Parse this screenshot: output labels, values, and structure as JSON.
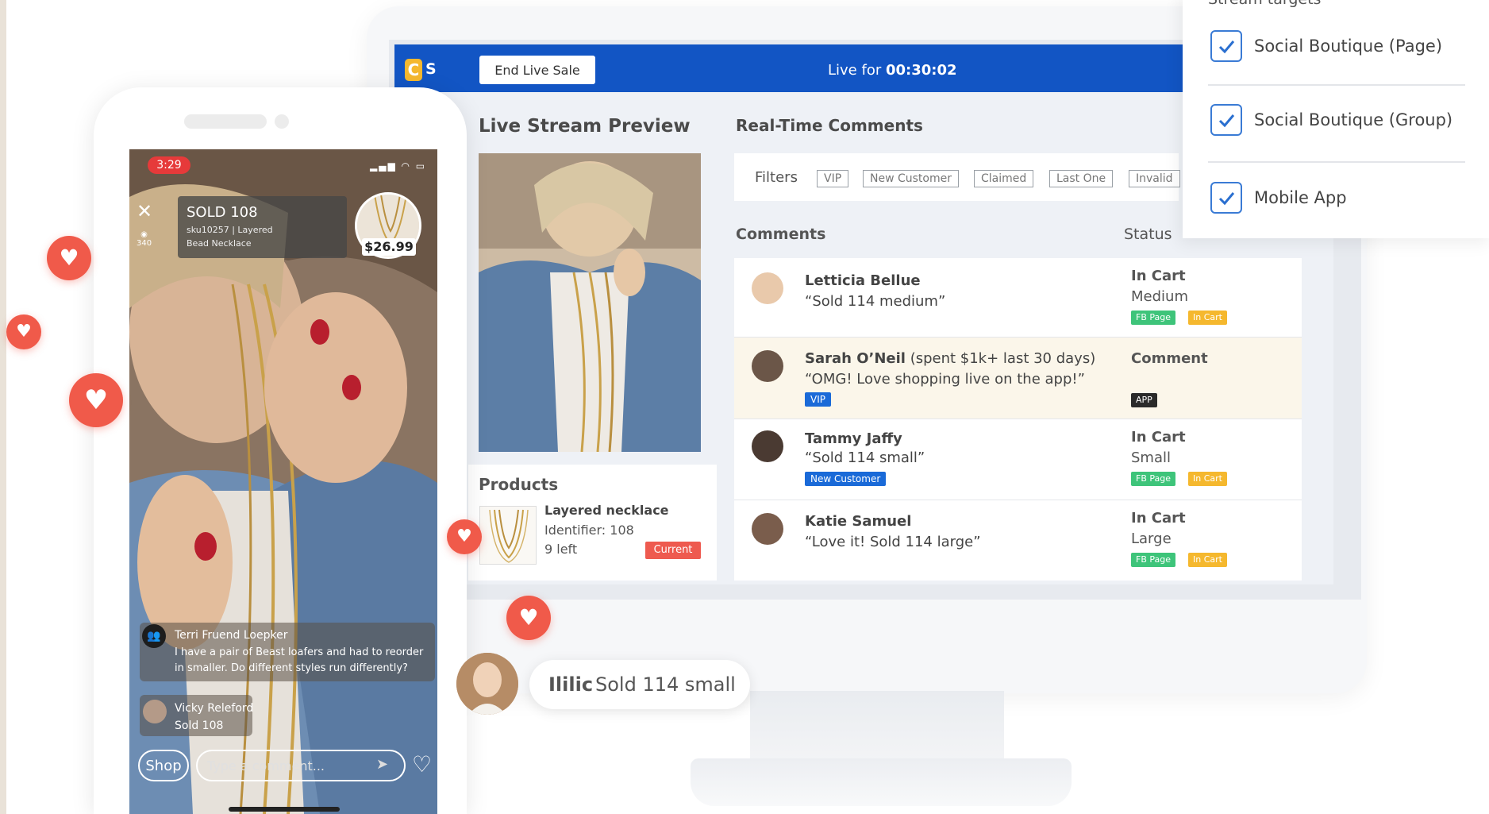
{
  "app": {
    "logo_text": "C",
    "logo_suffix": "S",
    "end_button": "End Live Sale",
    "live_prefix": "Live for ",
    "live_time": "00:30:02"
  },
  "preview": {
    "heading": "Live Stream Preview"
  },
  "realtime": {
    "heading": "Real-Time Comments",
    "filters_label": "Filters",
    "filters": [
      "VIP",
      "New Customer",
      "Claimed",
      "Last One",
      "Invalid"
    ],
    "col_comments": "Comments",
    "col_status": "Status"
  },
  "comments": [
    {
      "name": "Letticia Bellue",
      "extra": "",
      "text": "“Sold 114 medium”",
      "badge": "",
      "status": "In Cart",
      "size": "Medium",
      "tags": [
        "FB Page",
        "In Cart"
      ]
    },
    {
      "name": "Sarah O’Neil",
      "extra": " (spent $1k+ last 30 days)",
      "text": "“OMG! Love shopping live on the app!”",
      "badge": "VIP",
      "status": "Comment",
      "size": "",
      "tags": [
        "APP"
      ]
    },
    {
      "name": "Tammy Jaffy",
      "extra": "",
      "text": "“Sold 114 small”",
      "badge": "New Customer",
      "status": "In Cart",
      "size": "Small",
      "tags": [
        "FB Page",
        "In Cart"
      ]
    },
    {
      "name": "Katie Samuel",
      "extra": "",
      "text": "“Love it! Sold 114 large”",
      "badge": "",
      "status": "In Cart",
      "size": "Large",
      "tags": [
        "FB Page",
        "In Cart"
      ]
    }
  ],
  "products": {
    "heading": "Products",
    "name": "Layered necklace",
    "identifier": "Identifier: 108",
    "left": "9 left",
    "badge": "Current"
  },
  "stream_targets": {
    "title": "Stream targets",
    "items": [
      {
        "label": "Social Boutique (Page)",
        "checked": true
      },
      {
        "label": "Social Boutique (Group)",
        "checked": true
      },
      {
        "label": "Mobile App",
        "checked": true
      }
    ]
  },
  "phone": {
    "time": "3:29",
    "viewers": "340",
    "sold_title": "SOLD 108",
    "sold_sku_1": "sku10257 | Layered",
    "sold_sku_2": "Bead Necklace",
    "price": "$26.99",
    "chat": [
      {
        "name": "Terri Fruend Loepker",
        "line1": "I have a pair of Beast loafers and had to reorder",
        "line2": "in smaller. Do different styles run differently?"
      },
      {
        "name": "Vicky Releford",
        "line1": "Sold 108"
      }
    ],
    "shop_button": "Shop",
    "comment_placeholder": "Type a comment..."
  },
  "bottom_bubble": {
    "name": "Ililic",
    "text": "Sold 114 small"
  },
  "colors": {
    "brand_blue": "#1255c4",
    "heart_red": "#f05a4a",
    "fb_green": "#3ec47a",
    "cart_yellow": "#f5b82e",
    "vip_blue": "#1a6ad8",
    "highlight_row": "#fbf6ea"
  }
}
